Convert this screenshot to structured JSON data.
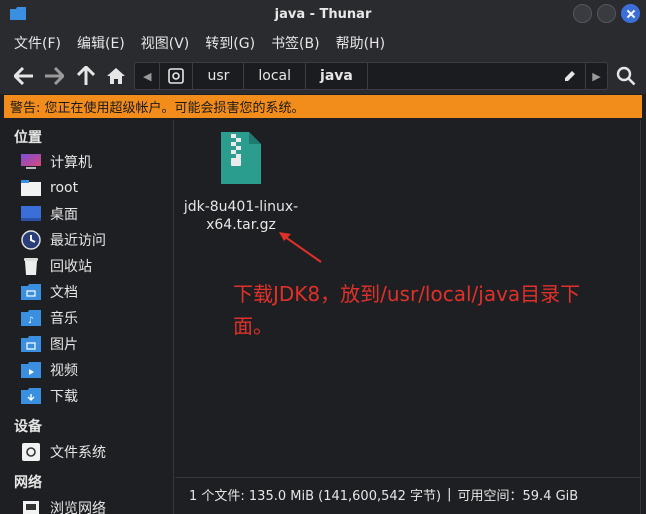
{
  "window": {
    "title": "java - Thunar"
  },
  "menu": [
    "文件(F)",
    "编辑(E)",
    "视图(V)",
    "转到(G)",
    "书签(B)",
    "帮助(H)"
  ],
  "path": {
    "segments": [
      "usr",
      "local",
      "java"
    ]
  },
  "warning": "警告: 您正在使用超级帐户。可能会损害您的系统。",
  "sidebar": {
    "places_title": "位置",
    "places": [
      "计算机",
      "root",
      "桌面",
      "最近访问",
      "回收站",
      "文档",
      "音乐",
      "图片",
      "视频",
      "下载"
    ],
    "devices_title": "设备",
    "devices": [
      "文件系统"
    ],
    "network_title": "网络",
    "network": [
      "浏览网络"
    ]
  },
  "file": {
    "name_line1": "jdk-8u401-linux-",
    "name_line2": "x64.tar.gz"
  },
  "annotation": {
    "line1": "下载JDK8，放到/usr/local/java目录下",
    "line2": "面。"
  },
  "status": {
    "files": "1 个文件: 135.0 MiB (141,600,542 字节)",
    "sep": "|",
    "free": "可用空间：59.4 GiB"
  },
  "colors": {
    "warning_bg": "#f28c1a",
    "annotation": "#e0302a",
    "file_icon": "#2a9d8f",
    "close_btn": "#3b6fd8"
  }
}
